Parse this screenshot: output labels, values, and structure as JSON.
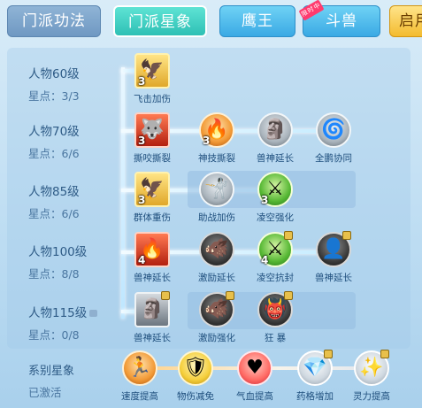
{
  "tabs": [
    {
      "label": "门派功法"
    },
    {
      "label": "门派星象"
    },
    {
      "label": "鹰王"
    },
    {
      "label": "斗兽",
      "badge": "限时中"
    },
    {
      "label": "启用"
    }
  ],
  "rows": [
    {
      "level": "人物60级",
      "stars": "星点：3/3",
      "locked": false,
      "skills": [
        {
          "name": "飞击加伤",
          "num": "3"
        }
      ]
    },
    {
      "level": "人物70级",
      "stars": "星点：6/6",
      "locked": false,
      "skills": [
        {
          "name": "撕咬撕裂",
          "num": "3"
        },
        {
          "name": "神技撕裂",
          "num": "3"
        },
        {
          "name": "兽神延长",
          "num": ""
        },
        {
          "name": "全鹏协同",
          "num": ""
        }
      ]
    },
    {
      "level": "人物85级",
      "stars": "星点：6/6",
      "locked": false,
      "skills": [
        {
          "name": "群体重伤",
          "num": "3"
        },
        {
          "name": "助战加伤",
          "num": ""
        },
        {
          "name": "凌空强化",
          "num": "3"
        }
      ]
    },
    {
      "level": "人物100级",
      "stars": "星点：8/8",
      "locked": false,
      "skills": [
        {
          "name": "兽神延长",
          "num": "4"
        },
        {
          "name": "激励延长",
          "num": ""
        },
        {
          "name": "凌空抗封",
          "num": "4"
        },
        {
          "name": "兽神延长",
          "num": ""
        }
      ]
    },
    {
      "level": "人物115级",
      "stars": "星点：0/8",
      "locked": true,
      "skills": [
        {
          "name": "兽神延长",
          "num": ""
        },
        {
          "name": "激励强化",
          "num": ""
        },
        {
          "name": "狂 暴",
          "num": ""
        }
      ]
    }
  ],
  "series": {
    "title": "系别星象",
    "status": "已激活",
    "skills": [
      {
        "name": "速度提高"
      },
      {
        "name": "物伤减免"
      },
      {
        "name": "气血提高"
      },
      {
        "name": "药格增加"
      },
      {
        "name": "灵力提高"
      }
    ]
  },
  "colors": {
    "active_tab": "#2ec0b5",
    "accent_gold": "#f2b227",
    "text_blue": "#1f4f7d"
  }
}
